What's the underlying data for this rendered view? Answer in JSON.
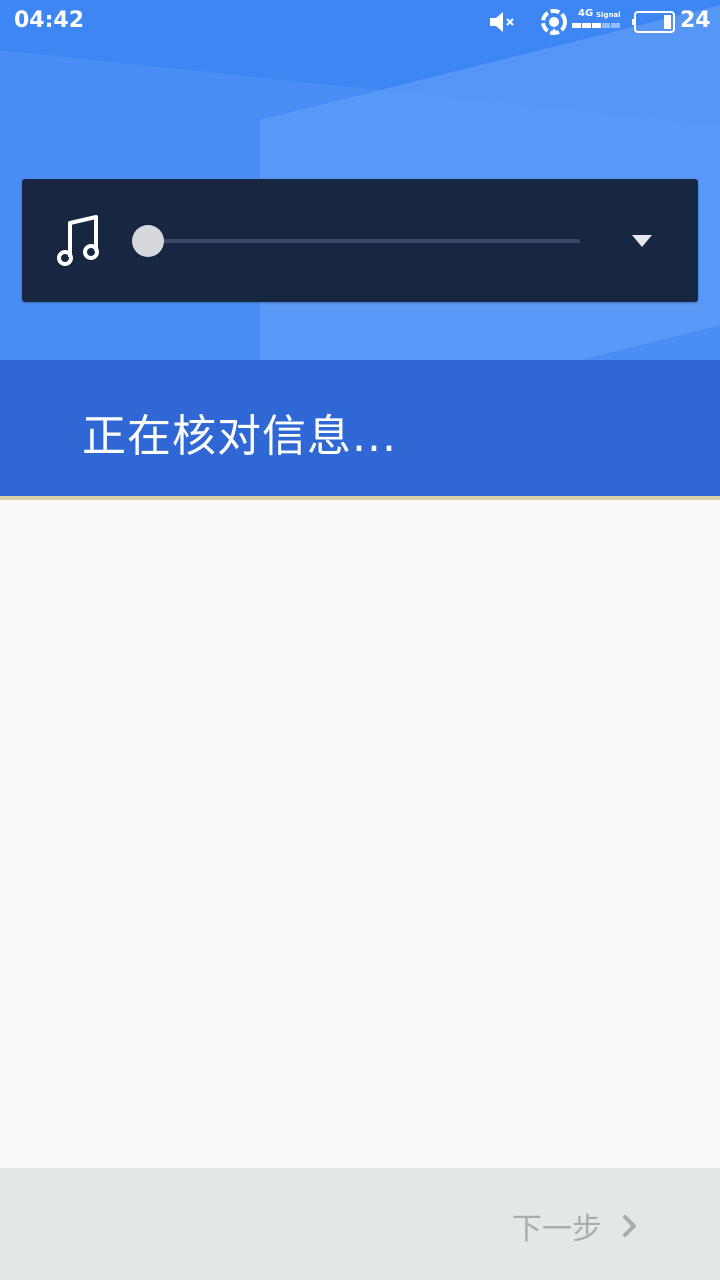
{
  "status_bar": {
    "time": "04:42",
    "network_type": "4G",
    "signal_label": "Signal",
    "battery_level": "24",
    "icons": [
      "mute-icon",
      "wifi-icon",
      "signal-icon",
      "battery-icon"
    ]
  },
  "player": {
    "icon": "music-note-icon",
    "progress": 0,
    "dropdown_icon": "triangle-down-icon"
  },
  "main": {
    "title": "正在核对信息..."
  },
  "footer": {
    "next_label": "下一步",
    "next_icon": "chevron-right-icon"
  },
  "colors": {
    "header_blue": "#3d86f3",
    "band_blue": "#2f68d4",
    "player_bg": "#172641",
    "footer_bg": "#e3e7e8",
    "disabled_text": "#a9adb0"
  }
}
